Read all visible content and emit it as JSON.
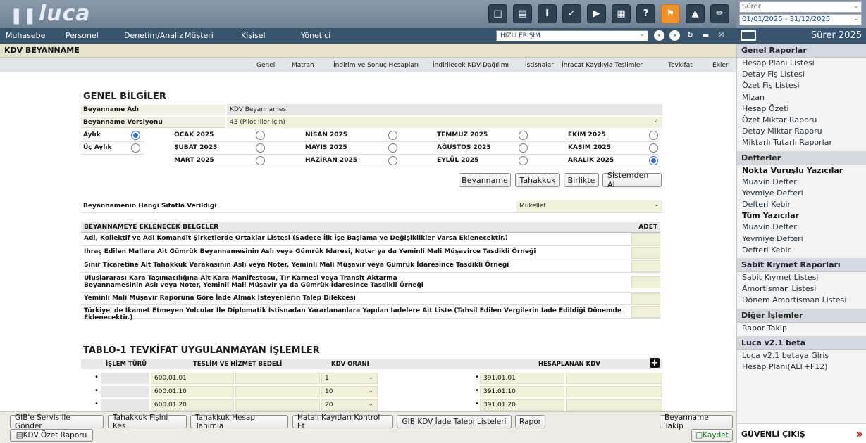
{
  "app": {
    "logo": "luca"
  },
  "toolbar_icons": [
    "note-icon",
    "book-icon",
    "info-icon",
    "help-circle-icon",
    "youtube-icon",
    "calculator-icon",
    "question-icon",
    "megaphone-icon",
    "bell-icon",
    "notebook-icon"
  ],
  "top_right": {
    "user": "Sürer",
    "period": "01/01/2025 - 31/12/2025"
  },
  "menu": {
    "items": [
      "Muhasebe",
      "Personel",
      "Denetim/Analiz",
      "Müşteri",
      "Kişisel",
      "Yönetici"
    ],
    "quick_access": "HIZLI ERİŞİM",
    "company": "Sürer 2025"
  },
  "page": {
    "title": "KDV BEYANNAME"
  },
  "tabs": [
    "Genel",
    "Matrah",
    "İndirim ve Sonuç Hesapları",
    "İndirilecek KDV Dağılımı",
    "İstisnalar",
    "İhracat Kaydıyla Teslimler",
    "Tevkifat",
    "Ekler"
  ],
  "general": {
    "heading": "GENEL BİLGİLER",
    "name_label": "Beyanname Adı",
    "name_value": "KDV Beyannamesi",
    "version_label": "Beyanname Versiyonu",
    "version_value": "43 (Pilot İller için)",
    "monthly": "Aylık",
    "quarterly": "Üç Aylık",
    "period_type_selected": "Aylık",
    "months": [
      "OCAK 2025",
      "ŞUBAT 2025",
      "MART 2025",
      "NİSAN 2025",
      "MAYIS 2025",
      "HAZİRAN 2025",
      "TEMMUZ 2025",
      "AĞUSTOS 2025",
      "EYLÜL 2025",
      "EKİM 2025",
      "KASIM 2025",
      "ARALIK 2025"
    ],
    "selected_month": "ARALIK 2025",
    "buttons": {
      "beyanname": "Beyanname",
      "tahakkuk": "Tahakkuk",
      "birlikte": "Birlikte",
      "sistemden_al": "Sistemden Al"
    },
    "capacity_label": "Beyannamenin Hangi Sıfatla Verildiği",
    "capacity_value": "Mükellef"
  },
  "documents": {
    "header": "BEYANNAMEYE EKLENECEK BELGELER",
    "adet": "ADET",
    "rows": [
      "Adi, Kollektif ve Adi Komandit Şirketlerde Ortaklar Listesi (Sadece İlk İşe Başlama ve Değişiklikler Varsa Eklenecektir.)",
      "İhraç Edilen Mallara Ait Gümrük Beyannamesinin Aslı veya Gümrük İdaresi, Noter ya da Yeminli Mali Müşavirce Tasdikli Örneği",
      "Sınır Ticaretine Ait Tahakkuk Varakasının Aslı veya Noter, Yeminli Mali Müşavir veya Gümrük İdaresince Tasdikli Örneği",
      "Uluslararası Kara Taşımacılığına Ait Kara Manifestosu, Tır Karnesi veya Transit Aktarma Beyannamesinin Aslı veya Noter, Yeminli Mali Müşavir ya da Gümrük İdaresince Tasdikli Örneği",
      "Yeminli Mali Müşavir Raporuna Göre İade Almak İsteyenlerin Talep Dilekcesi",
      "Türkiye' de İkamet Etmeyen Yolcular İle Diplomatik İstisnadan Yararlananlara Yapılan İadelere Ait Liste (Tahsil Edilen Vergilerin İade Edildiği Dönemde Eklenecektir.)"
    ]
  },
  "table1": {
    "heading": "TABLO-1 TEVKİFAT UYGULANMAYAN İŞLEMLER",
    "cols": {
      "islem": "İŞLEM TÜRÜ",
      "teslim": "TESLİM VE HİZMET BEDELİ",
      "kdv": "KDV ORANI",
      "hesaplanan": "HESAPLANAN KDV"
    },
    "rows": [
      {
        "teslim": "600.01.01",
        "oran": "1",
        "hesap": "391.01.01"
      },
      {
        "teslim": "600.01.10",
        "oran": "10",
        "hesap": "391.01.10"
      },
      {
        "teslim": "600.01.20",
        "oran": "20",
        "hesap": "391.01.20"
      }
    ]
  },
  "bottom": {
    "b1": "GIB'e Servis ile Gönder",
    "b2": "Tahakkuk Fişini Kes",
    "b3": "Tahakkuk Hesap Tanımla",
    "b4": "Hatalı Kayıtları Kontrol Et",
    "b5": "GIB KDV İade Talebi Listeleri",
    "b6": "Rapor",
    "b7": "Beyanname Takip",
    "b8": "KDV Özet Raporu",
    "b9": "Kaydet"
  },
  "sidebar": {
    "groups": [
      {
        "title": "Genel Raporlar",
        "items": [
          "Hesap Planı Listesi",
          "Detay Fiş Listesi",
          "Özet Fiş Listesi",
          "Mizan",
          "Hesap Özeti",
          "Özet Miktar Raporu",
          "Detay Miktar Raporu",
          "Miktarlı Tutarlı Raporlar"
        ]
      },
      {
        "title": "Defterler",
        "items": [
          "Nokta Vuruşlu Yazıcılar",
          "Muavin Defter",
          "Yevmiye Defteri",
          "Defteri Kebir",
          "Tüm Yazıcılar",
          "Muavin Defter",
          "Yevmiye Defteri",
          "Defteri Kebir"
        ]
      },
      {
        "title": "Sabit Kıymet Raporları",
        "items": [
          "Sabit Kıymet Listesi",
          "Amortisman Listesi",
          "Dönem Amortisman Listesi"
        ]
      },
      {
        "title": "Diğer İşlemler",
        "items": [
          "Rapor Takip"
        ]
      },
      {
        "title": "Luca v2.1 beta",
        "items": [
          "Luca v2.1 betaya Giriş",
          "Hesap Planı(ALT+F12)"
        ]
      }
    ],
    "logout": "GÜVENLİ ÇIKIŞ"
  }
}
